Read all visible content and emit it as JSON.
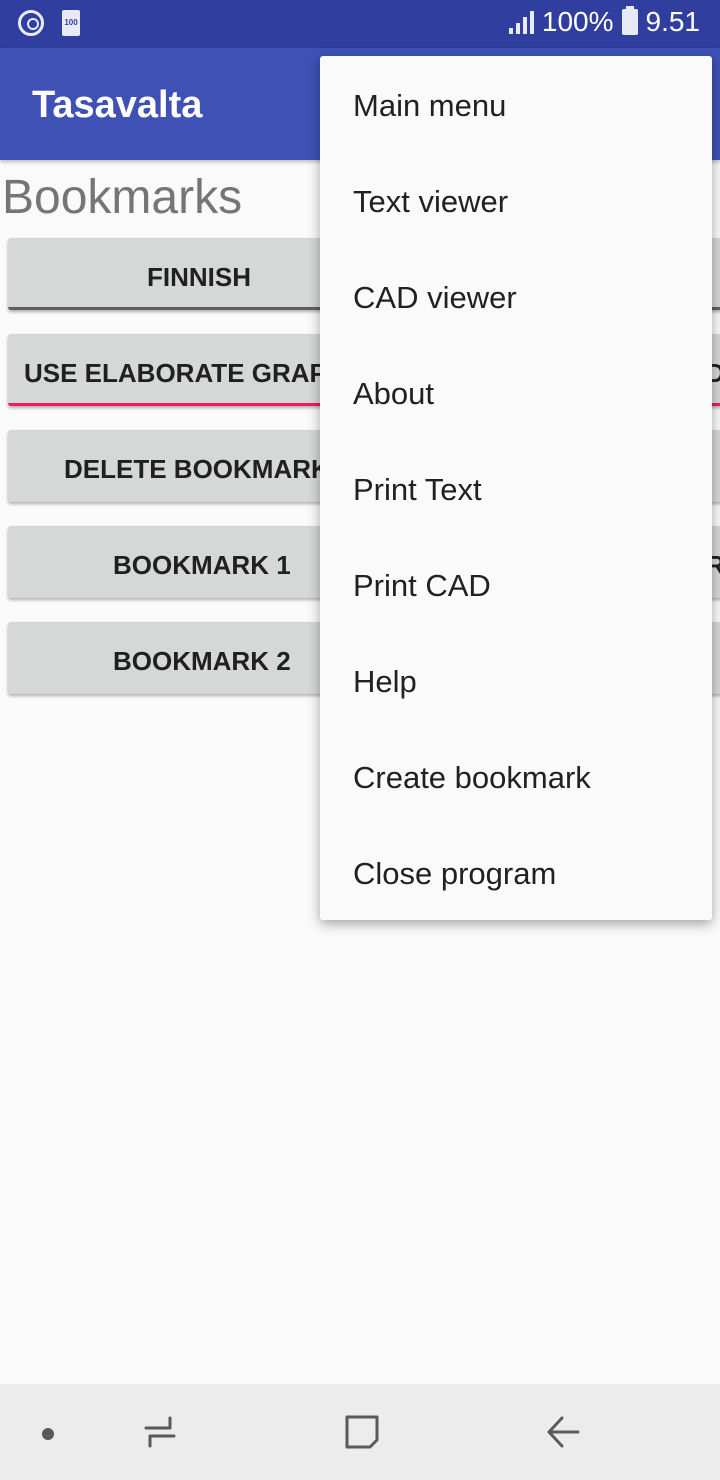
{
  "status_bar": {
    "battery_small_label": "100",
    "battery_percent": "100%",
    "time": "9.51"
  },
  "app_bar": {
    "title": "Tasavalta"
  },
  "page": {
    "heading": "Bookmarks"
  },
  "buttons": {
    "finnish": "FINNISH",
    "elaborate": "USE ELABORATE GRAPH",
    "delete": "DELETE BOOKMARK",
    "bookmark1": "BOOKMARK 1",
    "bookmark2": "BOOKMARK 2",
    "right_fragment_1": "D",
    "right_fragment_2": "R"
  },
  "menu": {
    "items": [
      "Main menu",
      "Text viewer",
      "CAD viewer",
      "About",
      "Print Text",
      "Print CAD",
      "Help",
      "Create bookmark",
      "Close program"
    ]
  },
  "colors": {
    "status_bar": "#303f9f",
    "app_bar": "#3f51b5",
    "accent": "#e91e63",
    "button_bg": "#d6d7d7"
  },
  "icons": {
    "status_left": [
      "sync-icon",
      "battery-100-icon"
    ],
    "status_right": [
      "signal-icon",
      "battery-icon"
    ],
    "nav": [
      "dot-icon",
      "recents-icon",
      "home-icon",
      "back-icon"
    ]
  }
}
